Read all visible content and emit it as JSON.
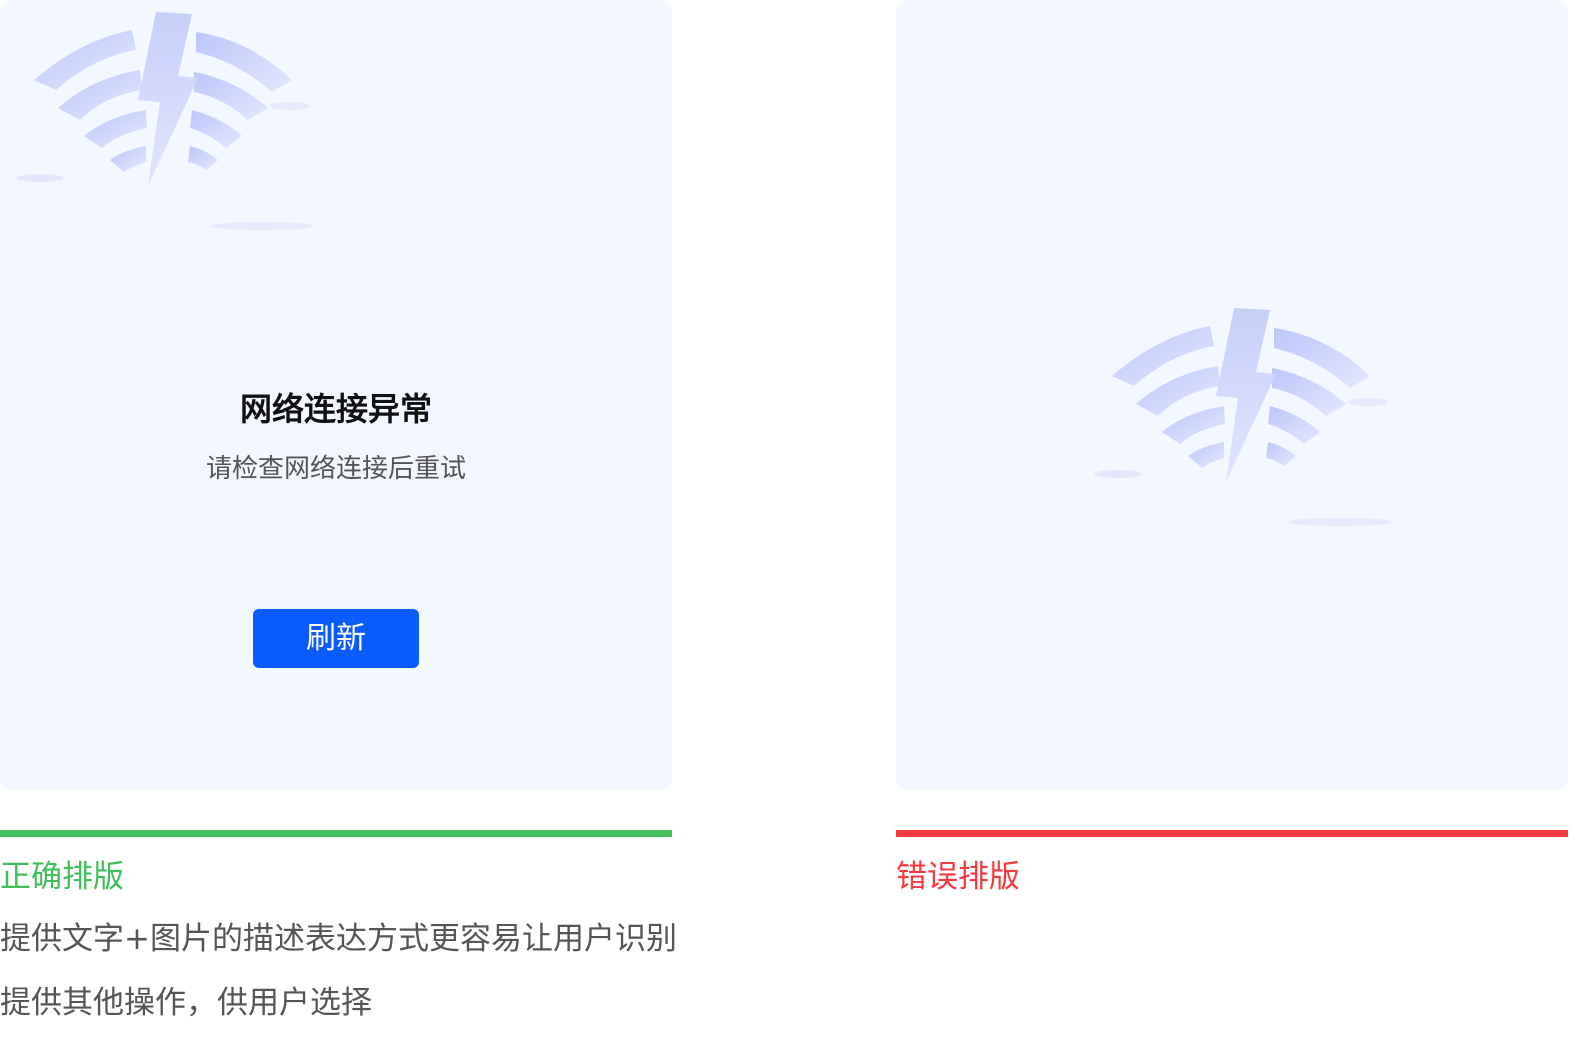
{
  "correct_panel": {
    "icon": "wifi-error-icon",
    "title": "网络连接异常",
    "subtitle": "请检查网络连接后重试",
    "refresh_label": "刷新"
  },
  "wrong_panel": {
    "icon": "wifi-error-icon"
  },
  "correct_caption": {
    "label": "正确排版",
    "color": "#45c05e",
    "notes": [
      "提供文字+图片的描述表达方式更容易让用户识别",
      "提供其他操作，供用户选择"
    ]
  },
  "wrong_caption": {
    "label": "错误排版",
    "color": "#f5393f"
  },
  "colors": {
    "panel_bg": "#f3f7ff",
    "button": "#0b5cff",
    "illustration": "#c7d0fb"
  }
}
